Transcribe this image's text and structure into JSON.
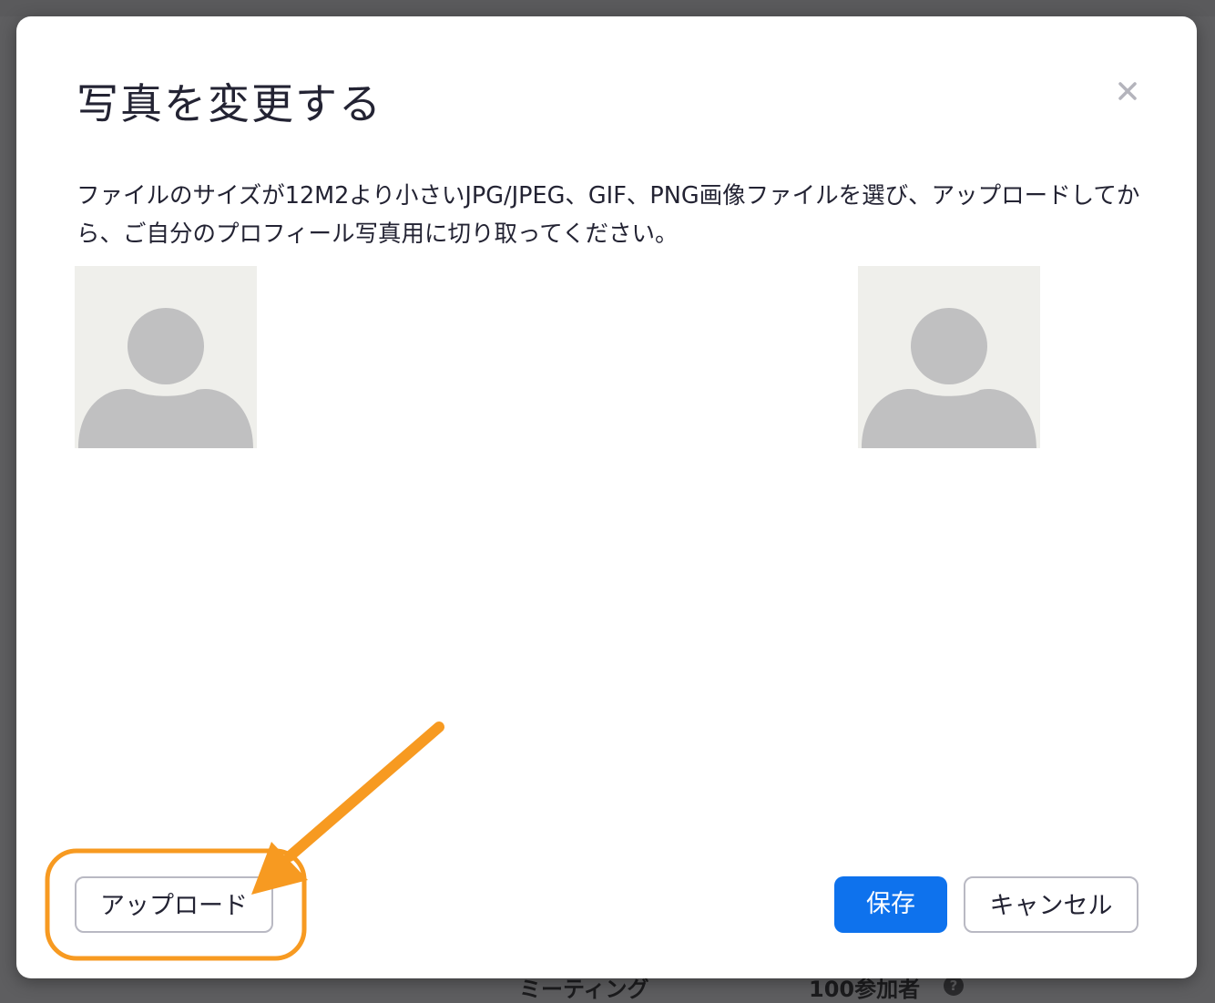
{
  "dialog": {
    "title": "写真を変更する",
    "description": "ファイルのサイズが12M2より小さいJPG/JPEG、GIF、PNG画像ファイルを選び、アップロードしてから、ご自分のプロフィール写真用に切り取ってください。",
    "buttons": {
      "upload": "アップロード",
      "save": "保存",
      "cancel": "キャンセル"
    }
  },
  "background_page": {
    "bottom_label": "ミーティング",
    "bottom_value": "100参加者",
    "help_glyph": "?"
  },
  "icons": {
    "close": "close-icon",
    "placeholder_avatar": "person-icon",
    "help": "help-icon"
  },
  "colors": {
    "primary": "#0e72ed",
    "annotation": "#f79a21",
    "avatar_bg": "#efefeb",
    "avatar_fg": "#c0c0c1"
  }
}
